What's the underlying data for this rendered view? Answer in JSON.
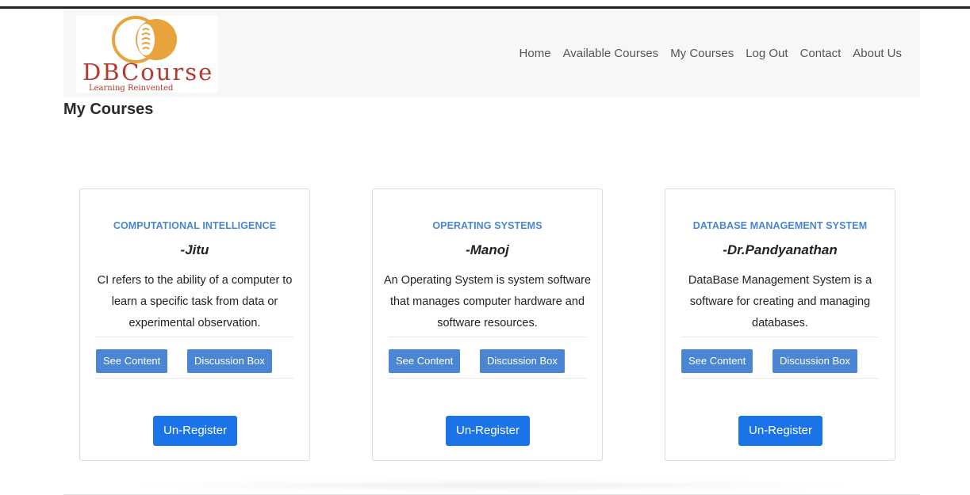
{
  "brand": {
    "logo_text": "DBCourse",
    "tagline": "Learning Reinvented"
  },
  "nav": {
    "items": [
      {
        "label": "Home"
      },
      {
        "label": "Available Courses"
      },
      {
        "label": "My Courses"
      },
      {
        "label": "Log Out"
      },
      {
        "label": "Contact"
      },
      {
        "label": "About Us"
      }
    ]
  },
  "page": {
    "title": "My Courses"
  },
  "courses": [
    {
      "title": "COMPUTATIONAL INTELLIGENCE",
      "author": "-Jitu",
      "description": "CI refers to the ability of a computer to learn a specific task from data or experimental observation.",
      "see_content_label": "See Content",
      "discussion_label": "Discussion Box",
      "unregister_label": "Un-Register"
    },
    {
      "title": "OPERATING SYSTEMS",
      "author": "-Manoj",
      "description": "An Operating System is system software that manages computer hardware and software resources.",
      "see_content_label": "See Content",
      "discussion_label": "Discussion Box",
      "unregister_label": "Un-Register"
    },
    {
      "title": "DATABASE MANAGEMENT SYSTEM",
      "author": "-Dr.Pandyanathan",
      "description": "DataBase Management System is a software for creating and managing databases.",
      "see_content_label": "See Content",
      "discussion_label": "Discussion Box",
      "unregister_label": "Un-Register"
    }
  ],
  "colors": {
    "accent": "#4a86d4",
    "primary_button": "#1a73e8",
    "logo_orange": "#e8a33c",
    "logo_red": "#b33a2e"
  }
}
